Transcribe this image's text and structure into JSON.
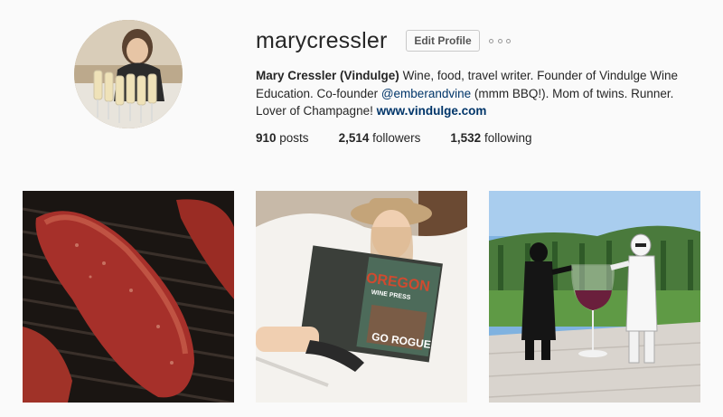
{
  "profile": {
    "username": "marycressler",
    "edit_button": "Edit Profile",
    "options_icon": "ellipsis-icon",
    "bio": {
      "full_name": "Mary Cressler (Vindulge)",
      "text_1": " Wine, food, travel writer. Founder of Vindulge Wine Education. Co-founder ",
      "mention": "@emberandvine",
      "text_2": " (mmm BBQ!). Mom of twins. Runner. Lover of Champagne! ",
      "url": "www.vindulge.com"
    },
    "stats": {
      "posts_count": "910",
      "posts_label": " posts",
      "followers_count": "2,514",
      "followers_label": " followers",
      "following_count": "1,532",
      "following_label": " following"
    }
  },
  "posts": [
    {
      "subject": "smoked meat on grill"
    },
    {
      "subject": "child reading Oregon Wine Press",
      "magazine_title": "OREGON",
      "magazine_subtitle": "WINE PRESS",
      "magazine_cover_line": "GO ROGUE"
    },
    {
      "subject": "toy figures toasting wine"
    }
  ]
}
